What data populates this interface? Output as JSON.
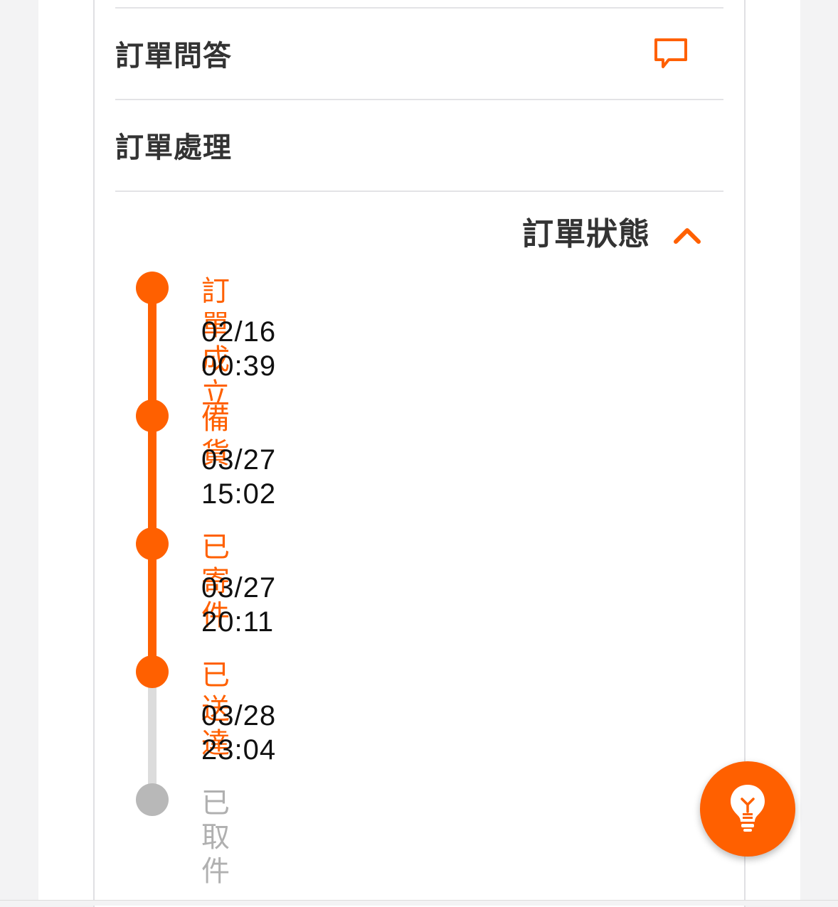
{
  "sections": {
    "qa_title": "訂單問答",
    "processing_title": "訂單處理"
  },
  "status": {
    "toggle_label": "訂單狀態",
    "steps": [
      {
        "label": "訂單成立",
        "time": "02/16 00:39",
        "state": "done"
      },
      {
        "label": "備貨",
        "time": "03/27 15:02",
        "state": "done"
      },
      {
        "label": "已寄件",
        "time": "03/27 20:11",
        "state": "done"
      },
      {
        "label": "已送達",
        "time": "03/28 23:04",
        "state": "done"
      },
      {
        "label": "已取件",
        "time": "",
        "state": "pending"
      }
    ]
  },
  "icons": {
    "qa": "chat-bubble-icon",
    "toggle": "chevron-up-icon",
    "fab": "lightbulb-icon"
  },
  "colors": {
    "accent": "#ff6000",
    "inactive_dot": "#b8b8b8",
    "inactive_line": "#dcdcdc",
    "inactive_text": "#b0b0b0"
  }
}
